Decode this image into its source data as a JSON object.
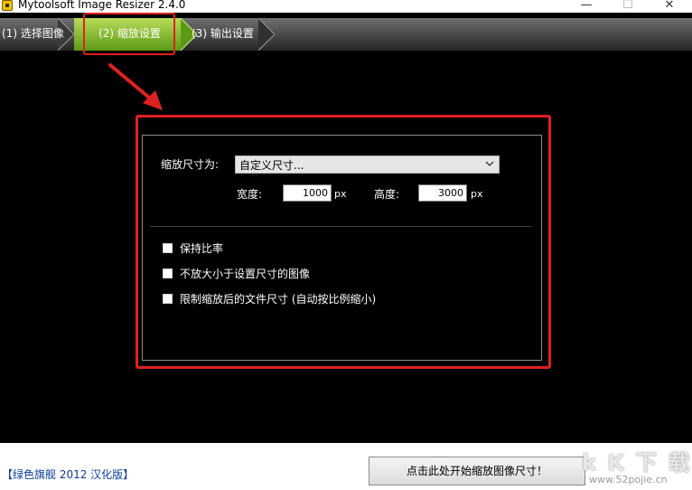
{
  "window": {
    "title": "Mytoolsoft Image Resizer 2.4.0",
    "min_glyph": "—",
    "max_glyph": "☐",
    "close_glyph": "✕"
  },
  "tabs": [
    {
      "label": "(1) 选择图像"
    },
    {
      "label": "(2) 缩放设置",
      "active": true
    },
    {
      "label": "(3) 输出设置"
    }
  ],
  "settings": {
    "scale_label": "缩放尺寸为:",
    "scale_value": "自定义尺寸...",
    "width_label": "宽度:",
    "width_value": "1000",
    "height_label": "高度:",
    "height_value": "3000",
    "unit": "px",
    "options": [
      {
        "label": "保持比率",
        "checked": false
      },
      {
        "label": "不放大小于设置尺寸的图像",
        "checked": false
      },
      {
        "label": "限制缩放后的文件尺寸 (自动按比例缩小)",
        "checked": false
      }
    ]
  },
  "footer": {
    "link": "【绿色旗舰 2012 汉化版】",
    "start_button": "点击此处开始缩放图像尺寸！"
  },
  "watermark": {
    "big": "k K 下 载",
    "small": "www.52pojie.cn"
  },
  "colors": {
    "accent": "#7fbf2a",
    "annotation": "#e02020",
    "link": "#0b3c9a"
  }
}
